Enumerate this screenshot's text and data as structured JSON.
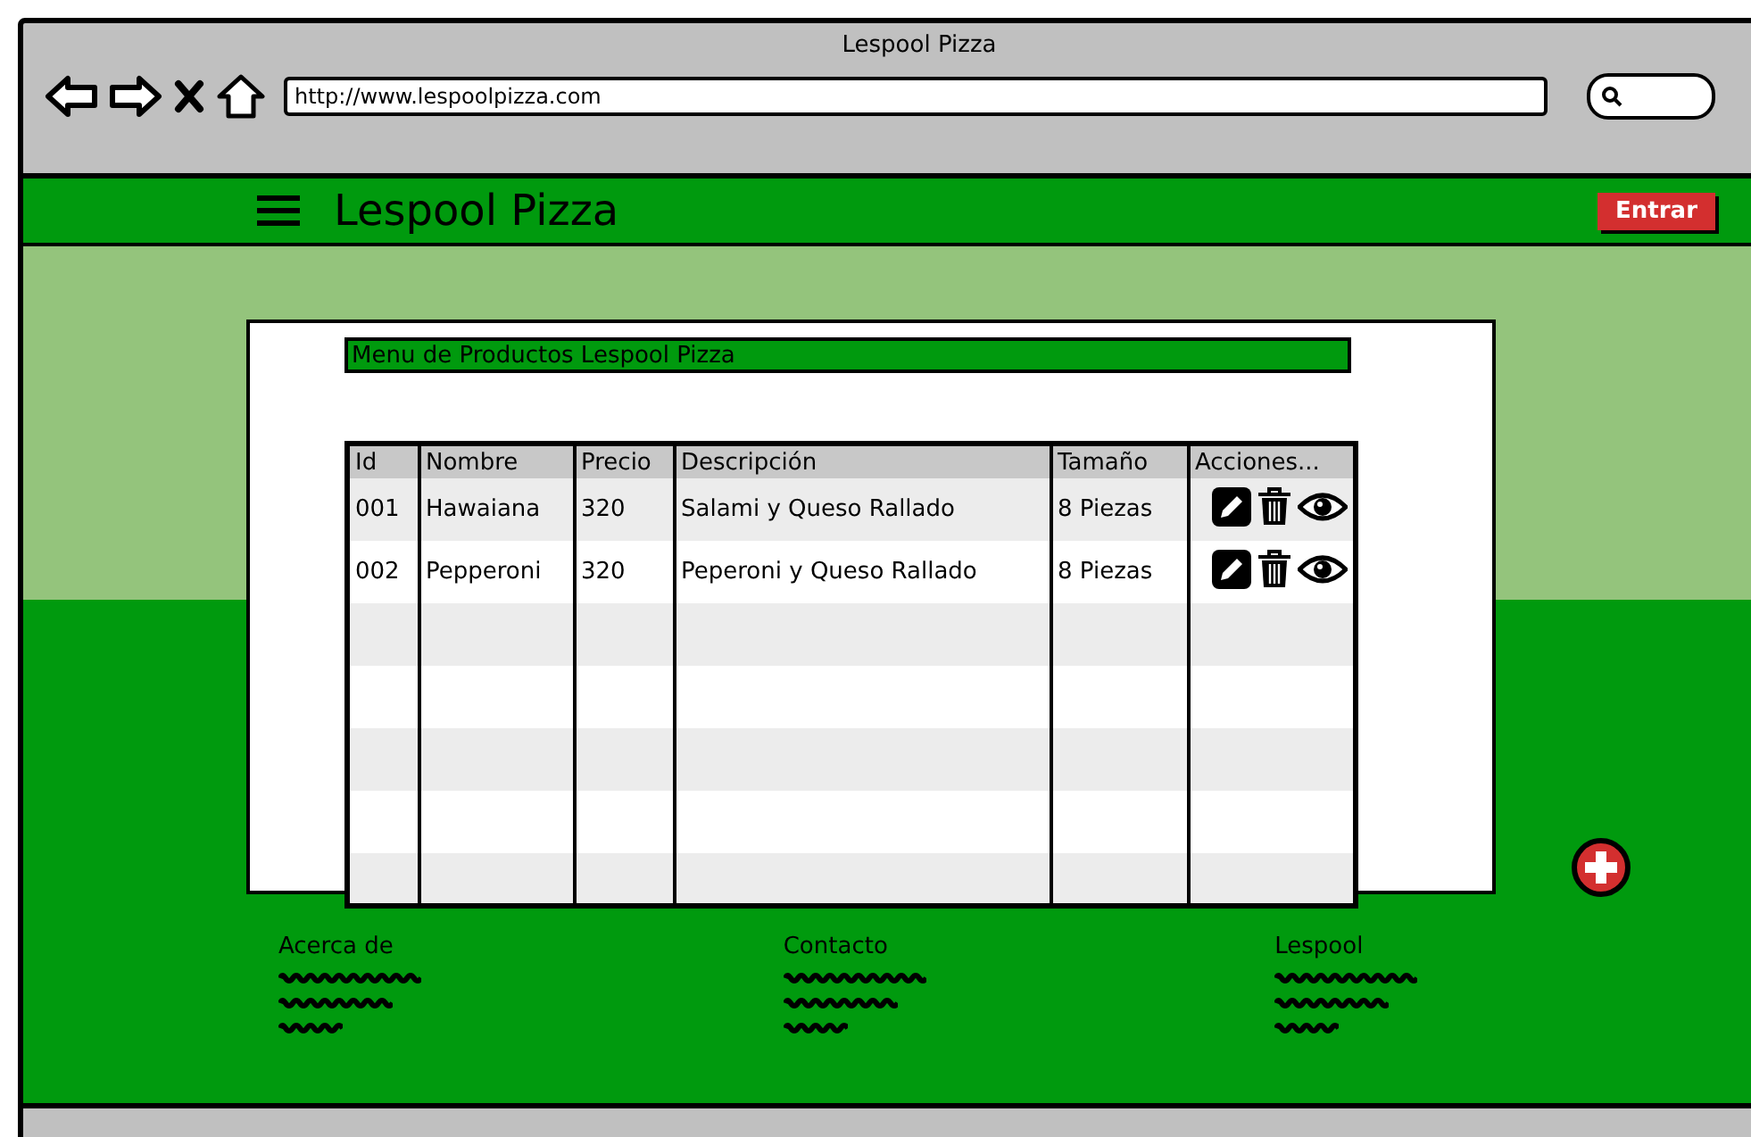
{
  "window": {
    "title": "Lespool Pizza",
    "url": "http://www.lespoolpizza.com"
  },
  "header": {
    "title": "Lespool Pizza",
    "login_button": "Entrar"
  },
  "panel": {
    "title": "Menu de Productos Lespool Pizza"
  },
  "table": {
    "columns": [
      "Id",
      "Nombre",
      "Precio",
      "Descripción",
      "Tamaño",
      "Acciones..."
    ],
    "rows": [
      {
        "cells": [
          "001",
          "Hawaiana",
          "320",
          "Salami y Queso Rallado",
          "8 Piezas"
        ]
      },
      {
        "cells": [
          "002",
          "Pepperoni",
          "320",
          "Peperoni y Queso Rallado",
          "8 Piezas"
        ]
      }
    ]
  },
  "footer": {
    "columns": [
      {
        "title": "Acerca de"
      },
      {
        "title": "Contacto"
      },
      {
        "title": "Lespool"
      }
    ]
  }
}
